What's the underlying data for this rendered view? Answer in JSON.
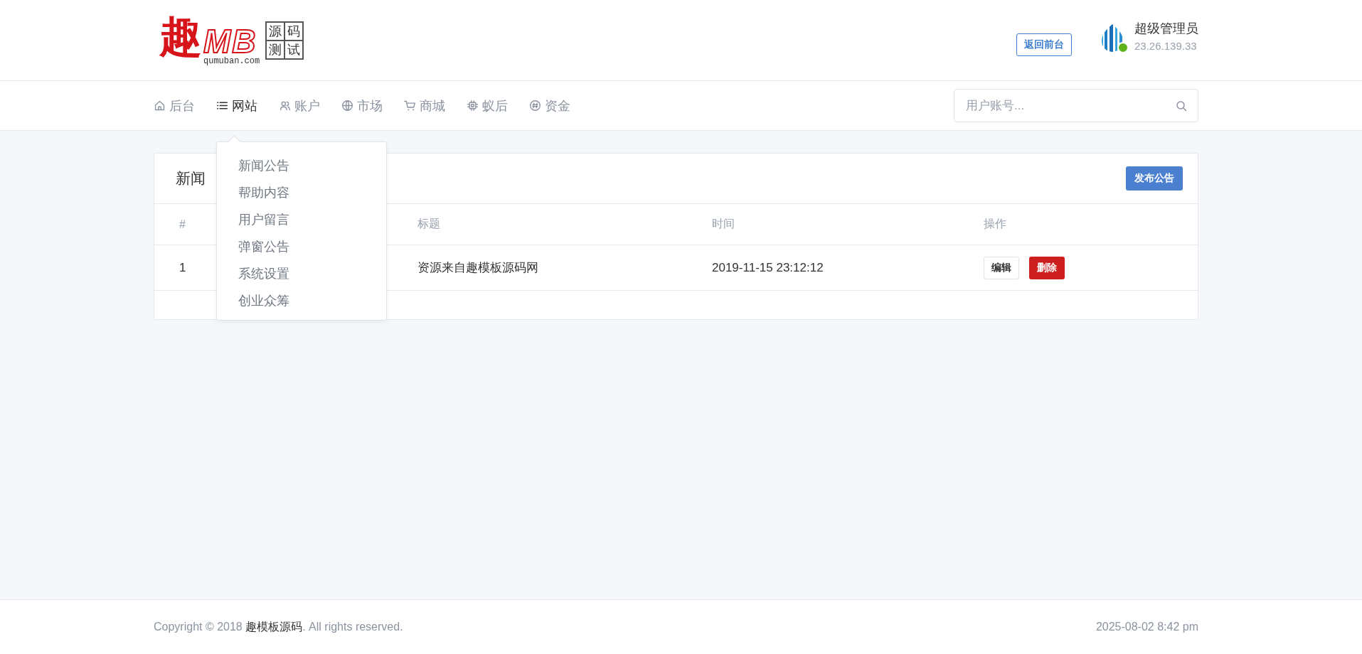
{
  "logo": {
    "mark": "趣",
    "letters": "MB",
    "domain": "qumuban.com",
    "grid": [
      "源",
      "码",
      "测",
      "试"
    ]
  },
  "header": {
    "front_button": "返回前台",
    "user": {
      "name": "超级管理员",
      "ip": "23.26.139.33",
      "online": true
    }
  },
  "nav": {
    "items": [
      {
        "label": "后台",
        "selected": false
      },
      {
        "label": "网站",
        "selected": true,
        "menu": [
          "新闻公告",
          "帮助内容",
          "用户留言",
          "弹窗公告",
          "系统设置",
          "创业众筹"
        ]
      },
      {
        "label": "账户",
        "selected": false
      },
      {
        "label": "市场",
        "selected": false
      },
      {
        "label": "商城",
        "selected": false
      },
      {
        "label": "蚁后",
        "selected": false
      },
      {
        "label": "资金",
        "selected": false
      }
    ],
    "search": {
      "placeholder": "用户账号..."
    }
  },
  "card": {
    "title": "新闻",
    "publish_button": "发布公告",
    "table": {
      "columns": [
        "#",
        "标题",
        "时间",
        "操作"
      ],
      "rows": [
        {
          "id": "1",
          "title": "资源来自趣模板源码网",
          "time": "2019-11-15 23:12:12",
          "edit": "编辑",
          "delete": "删除"
        }
      ]
    }
  },
  "footer": {
    "copyright_prefix": "Copyright © 2018 ",
    "brand_link": "趣模板源码",
    "copyright_suffix": ". All rights reserved.",
    "date": "2025-08-02 8:42 pm"
  }
}
